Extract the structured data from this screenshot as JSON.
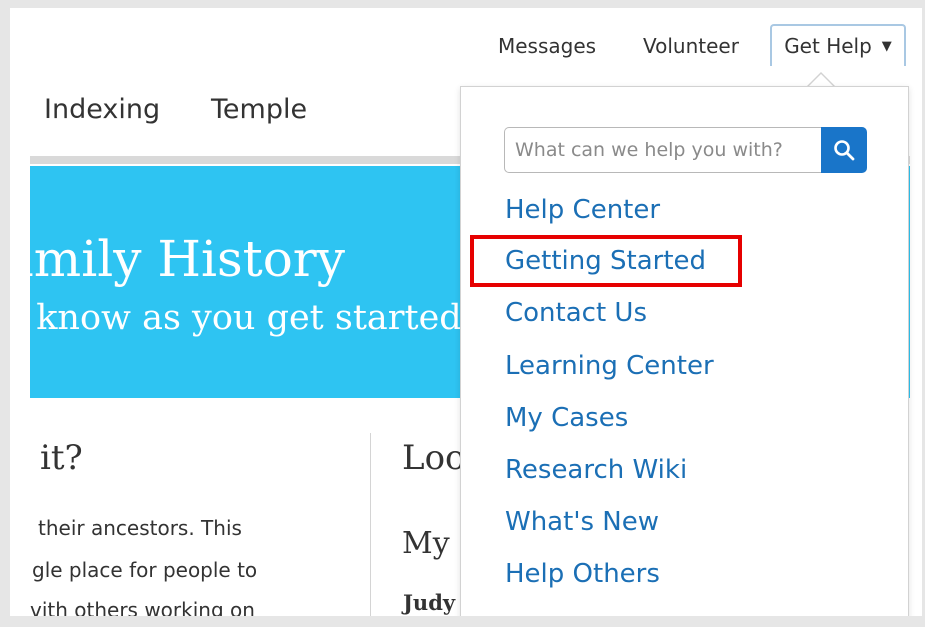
{
  "top_nav": {
    "messages": "Messages",
    "volunteer": "Volunteer",
    "get_help": "Get Help",
    "caret": "▼"
  },
  "main_nav": {
    "indexing": "Indexing",
    "temple": "Temple"
  },
  "hero": {
    "title": "amily History",
    "subtitle": "o know as you get started"
  },
  "left_column": {
    "heading": "it?",
    "lines": [
      "their ancestors. This",
      "gle place for people to",
      "vith others working on"
    ]
  },
  "right_column": {
    "heading": "Loo",
    "my_label": "My",
    "name": "Judy"
  },
  "dropdown": {
    "search_placeholder": "What can we help you with?",
    "items": [
      "Help Center",
      "Getting Started",
      "Contact Us",
      "Learning Center",
      "My Cases",
      "Research Wiki",
      "What's New",
      "Help Others"
    ]
  },
  "colors": {
    "link": "#1b6fb5",
    "hero": "#2ec4f2",
    "search_button": "#1975c9",
    "highlight": "#e60000"
  }
}
